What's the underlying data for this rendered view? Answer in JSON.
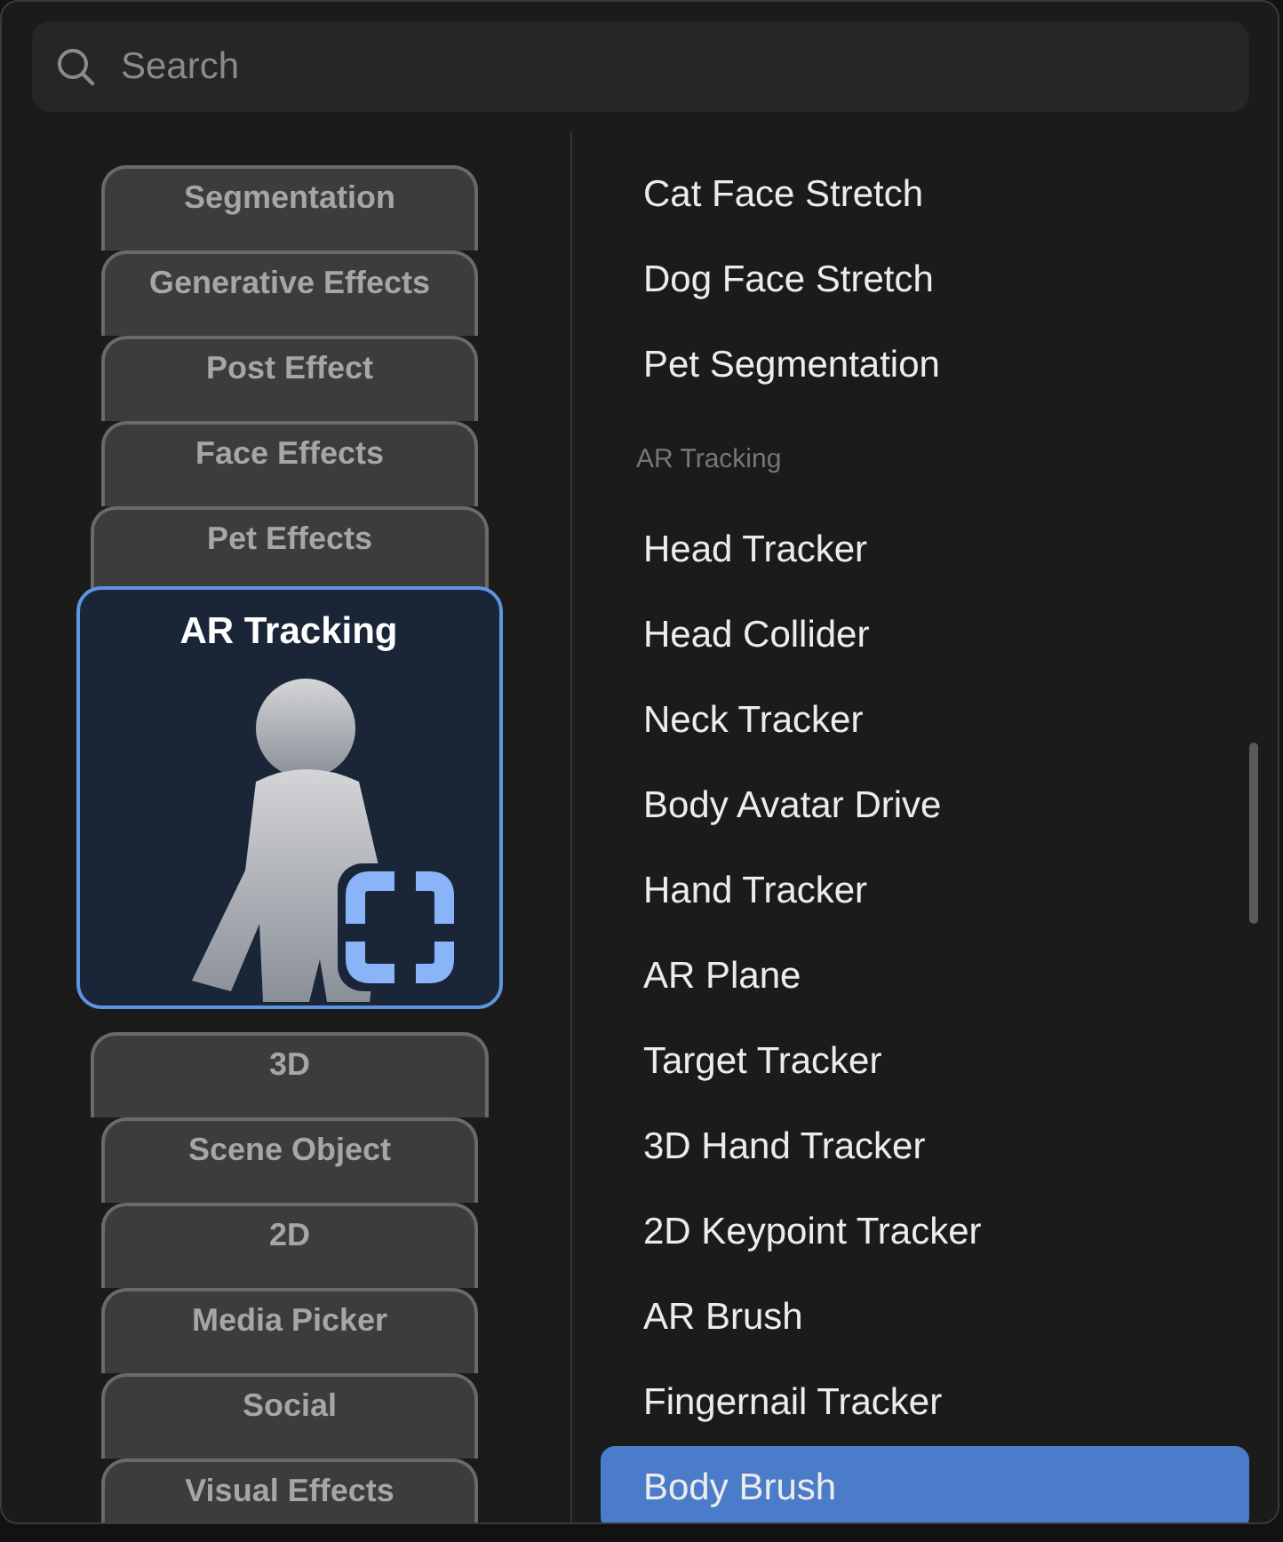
{
  "search": {
    "placeholder": "Search"
  },
  "categories": [
    {
      "label": "Segmentation",
      "selected": false
    },
    {
      "label": "Generative Effects",
      "selected": false
    },
    {
      "label": "Post Effect",
      "selected": false
    },
    {
      "label": "Face Effects",
      "selected": false
    },
    {
      "label": "Pet Effects",
      "selected": false
    },
    {
      "label": "AR Tracking",
      "selected": true
    },
    {
      "label": "3D",
      "selected": false
    },
    {
      "label": "Scene Object",
      "selected": false
    },
    {
      "label": "2D",
      "selected": false
    },
    {
      "label": "Media Picker",
      "selected": false
    },
    {
      "label": "Social",
      "selected": false
    },
    {
      "label": "Visual Effects",
      "selected": false
    }
  ],
  "items": [
    {
      "kind": "item",
      "label": "Cat Face Stretch",
      "selected": false
    },
    {
      "kind": "item",
      "label": "Dog Face Stretch",
      "selected": false
    },
    {
      "kind": "item",
      "label": "Pet Segmentation",
      "selected": false
    },
    {
      "kind": "header",
      "label": "AR Tracking"
    },
    {
      "kind": "item",
      "label": "Head Tracker",
      "selected": false
    },
    {
      "kind": "item",
      "label": "Head Collider",
      "selected": false
    },
    {
      "kind": "item",
      "label": "Neck Tracker",
      "selected": false
    },
    {
      "kind": "item",
      "label": "Body Avatar Drive",
      "selected": false
    },
    {
      "kind": "item",
      "label": "Hand Tracker",
      "selected": false
    },
    {
      "kind": "item",
      "label": "AR Plane",
      "selected": false
    },
    {
      "kind": "item",
      "label": "Target Tracker",
      "selected": false
    },
    {
      "kind": "item",
      "label": "3D Hand Tracker",
      "selected": false
    },
    {
      "kind": "item",
      "label": "2D Keypoint Tracker",
      "selected": false
    },
    {
      "kind": "item",
      "label": "AR Brush",
      "selected": false
    },
    {
      "kind": "item",
      "label": "Fingernail Tracker",
      "selected": false
    },
    {
      "kind": "item",
      "label": "Body Brush",
      "selected": true
    }
  ]
}
